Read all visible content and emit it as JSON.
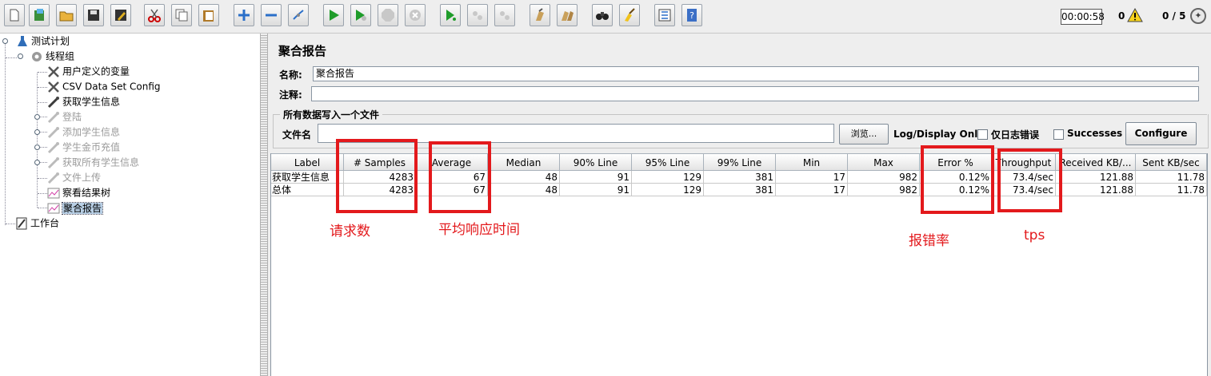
{
  "toolbar": {
    "timer": "00:00:58",
    "error_count": "0",
    "threads": "0 / 5"
  },
  "tree": {
    "root": "测试计划",
    "thread_group": "线程组",
    "items": [
      {
        "label": "用户定义的变量",
        "disabled": false
      },
      {
        "label": "CSV Data Set Config",
        "disabled": false
      },
      {
        "label": "获取学生信息",
        "disabled": false
      },
      {
        "label": "登陆",
        "disabled": true
      },
      {
        "label": "添加学生信息",
        "disabled": true
      },
      {
        "label": "学生金币充值",
        "disabled": true
      },
      {
        "label": "获取所有学生信息",
        "disabled": true
      },
      {
        "label": "文件上传",
        "disabled": true
      },
      {
        "label": "察看结果树",
        "disabled": false
      },
      {
        "label": "聚合报告",
        "disabled": false,
        "selected": true
      }
    ],
    "workbench": "工作台"
  },
  "panel": {
    "title": "聚合报告",
    "name_label": "名称:",
    "name_value": "聚合报告",
    "comment_label": "注释:",
    "comment_value": "",
    "fileset_title": "所有数据写入一个文件",
    "filename_label": "文件名",
    "filename_value": "",
    "browse_label": "浏览...",
    "log_only_label": "Log/Display Only:",
    "errors_only_label": "仅日志错误",
    "successes_label": "Successes",
    "configure_label": "Configure"
  },
  "table": {
    "columns": [
      "Label",
      "# Samples",
      "Average",
      "Median",
      "90% Line",
      "95% Line",
      "99% Line",
      "Min",
      "Max",
      "Error %",
      "Throughput",
      "Received KB/...",
      "Sent KB/sec"
    ],
    "rows": [
      [
        "获取学生信息",
        "4283",
        "67",
        "48",
        "91",
        "129",
        "381",
        "17",
        "982",
        "0.12%",
        "73.4/sec",
        "121.88",
        "11.78"
      ],
      [
        "总体",
        "4283",
        "67",
        "48",
        "91",
        "129",
        "381",
        "17",
        "982",
        "0.12%",
        "73.4/sec",
        "121.88",
        "11.78"
      ]
    ]
  },
  "annotations": {
    "samples": "请求数",
    "average": "平均响应时间",
    "error": "报错率",
    "throughput": "tps",
    "color": "#e3191c"
  },
  "colors": {
    "selection": "#b8cfe5",
    "disabled_text": "#9a9a9a",
    "panel_bg": "#eeeeee"
  }
}
